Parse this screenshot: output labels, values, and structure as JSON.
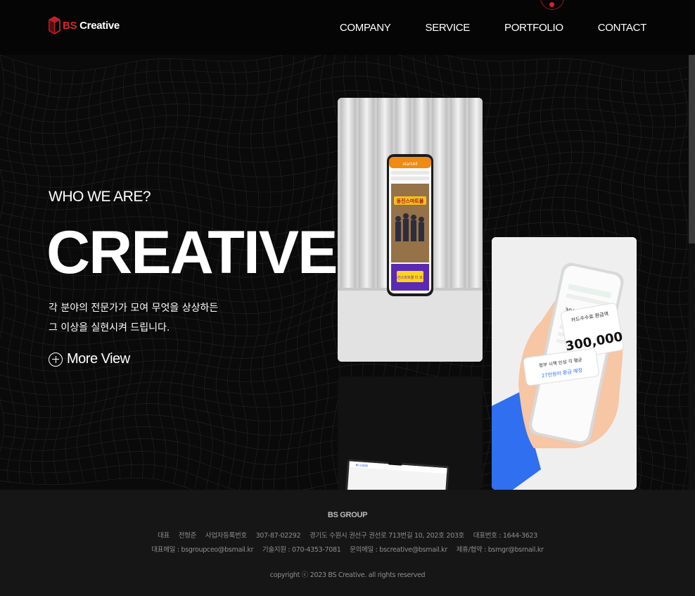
{
  "header": {
    "logo_prefix": "BS",
    "logo_word": "Creative",
    "nav": [
      {
        "label": "COMPANY"
      },
      {
        "label": "SERVICE"
      },
      {
        "label": "PORTFOLIO"
      },
      {
        "label": "CONTACT"
      }
    ]
  },
  "hero": {
    "eyebrow": "WHO WE ARE?",
    "headline": "CREATIVE",
    "desc_line1": "각 분야의 전문가가 모여 무엇을 상상하든",
    "desc_line2": "그 이상을 실현시켜 드립니다.",
    "more_label": "More View"
  },
  "cards": {
    "card1": {
      "top_label": "startAll",
      "poster_title": "동진스마트몰",
      "cta": "동진스마트몰 더 보기"
    },
    "card2": {
      "bubble1_label": "카드수수료 환급액",
      "bubble1_value": "300,000",
      "bubble2_label": "정부 시책 인상 각 평균",
      "bubble2_value": "27만원이 환급 예정",
      "phone_value": "300,000"
    },
    "card3": {
      "laptop_label": "BS LOAD"
    }
  },
  "footer": {
    "brand": "BS GROUP",
    "line1": [
      "대표",
      "전형준",
      "사업자등록번호",
      "307-87-02292",
      "경기도 수원시 권선구 권선로 713번길 10, 202호 203호",
      "대표번호 : 1644-3623"
    ],
    "line2": [
      "대표메일 : bsgroupceo@bsmail.kr",
      "기술지원 : 070-4353-7081",
      "문의메일 : bscreative@bsmail.kr",
      "제휴/협약 : bsmgr@bsmail.kr"
    ],
    "copyright": "copyright ⓒ 2023 BS Creative. all rights reserved"
  },
  "colors": {
    "accent": "#e01e27",
    "background": "#000000",
    "footer_bg": "#161616"
  }
}
